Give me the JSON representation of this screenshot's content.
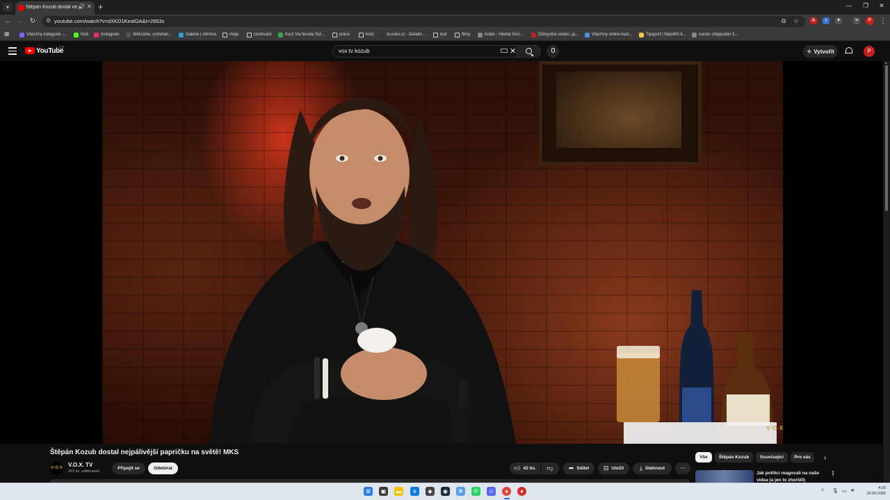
{
  "browser": {
    "tab_title": "Štěpán Kozub dostal nejpáli",
    "url": "youtube.com/watch?v=dXKD1KealGA&t=2853s",
    "bookmarks": [
      {
        "label": "Všechny kategorie -...",
        "color": "#7b61ff"
      },
      {
        "label": "Kick",
        "color": "#53fc18"
      },
      {
        "label": "Instagram",
        "color": "#e1306c"
      },
      {
        "label": "Welcome, comman...",
        "color": "#555555"
      },
      {
        "label": "Galerie | ohmnia",
        "color": "#2a9fd6"
      },
      {
        "label": "moje",
        "color": "folder"
      },
      {
        "label": "cestování",
        "color": "folder"
      },
      {
        "label": "Kurz Via ferrata Sol...",
        "color": "#3fa34d"
      },
      {
        "label": "práce",
        "color": "folder"
      },
      {
        "label": "kodi",
        "color": "folder"
      },
      {
        "label": "vLesku.cz - Detailn...",
        "color": "#333333"
      },
      {
        "label": "kcd",
        "color": "folder"
      },
      {
        "label": "filmy",
        "color": "folder"
      },
      {
        "label": "hriató - Hledat Goo...",
        "color": "#888888"
      },
      {
        "label": "Důmyslné umění, ja...",
        "color": "#c5221f"
      },
      {
        "label": "Všechny online kurz...",
        "color": "#4a90e2"
      },
      {
        "label": "Tipsport | Největší k...",
        "color": "#f2c94c"
      },
      {
        "label": "naruto shippuden 3...",
        "color": "#888888"
      }
    ]
  },
  "youtube": {
    "logo_text": "YouTube",
    "region": "CZ",
    "search_value": "vox tv kozub",
    "create_label": "Vytvořit",
    "avatar_letter": "P"
  },
  "player": {
    "watermark": "V·O·X"
  },
  "video": {
    "title": "Štěpán Kozub dostal nejpálivější papričku na světě! MKS",
    "channel_name": "V.O.X. TV",
    "channel_avatar_text": "V·O·X",
    "subscribers": "202 tis. odběratelů",
    "join_label": "Připojit se",
    "subscribe_label": "Odebírat",
    "likes": "42 tis.",
    "share_label": "Sdílet",
    "save_label": "Uložit",
    "download_label": "Stáhnout"
  },
  "sidebar": {
    "chips": [
      "Vše",
      "Štěpán Kozub",
      "Související",
      "Pro vás"
    ],
    "recommendation_title": "Jak politici reagovali na naše videa (a jen to zhoršili)"
  },
  "taskbar": {
    "time": "4:20",
    "date": "22.03.2026"
  }
}
